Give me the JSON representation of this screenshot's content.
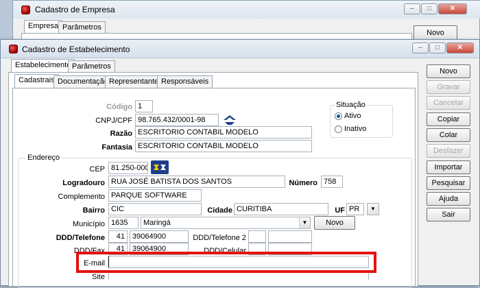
{
  "bg_window": {
    "title": "Cadastro de Empresa",
    "tabs": [
      "Empresa",
      "Parâmetros"
    ],
    "novo_label": "Novo"
  },
  "window": {
    "title": "Cadastro de Estabelecimento",
    "tabs": [
      "Estabelecimento",
      "Parâmetros"
    ],
    "subtabs": [
      "Cadastrais",
      "Documentação",
      "Representante",
      "Responsáveis"
    ]
  },
  "buttons": {
    "novo": "Novo",
    "gravar": "Gravar",
    "cancelar": "Cancelar",
    "copiar": "Copiar",
    "colar": "Colar",
    "desfazer": "Desfazer",
    "importar": "Importar",
    "pesquisar": "Pesquisar",
    "ajuda": "Ajuda",
    "sair": "Sair"
  },
  "form": {
    "codigo_label": "Código",
    "codigo": "1",
    "cnpj_label": "CNPJ/CPF",
    "cnpj": "98.765.432/0001-98",
    "razao_label": "Razão",
    "razao": "ESCRITORIO CONTABIL MODELO",
    "fantasia_label": "Fantasia",
    "fantasia": "ESCRITORIO CONTABIL MODELO",
    "situacao_title": "Situação",
    "situacao_ativo": "Ativo",
    "situacao_inativo": "Inativo",
    "endereco_title": "Endereço",
    "cep_label": "CEP",
    "cep": "81.250-000",
    "logradouro_label": "Logradouro",
    "logradouro": "RUA JOSÉ BATISTA DOS SANTOS",
    "numero_label": "Número",
    "numero": "758",
    "complemento_label": "Complemento",
    "complemento": "PARQUE SOFTWARE",
    "bairro_label": "Bairro",
    "bairro": "CIC",
    "cidade_label": "Cidade",
    "cidade": "CURITIBA",
    "uf_label": "UF",
    "uf": "PR",
    "municipio_label": "Município",
    "municipio_code": "1635",
    "municipio": "Maringá",
    "municipio_novo": "Novo",
    "ddd_tel_label": "DDD/Telefone",
    "ddd_tel": "41",
    "tel": "39064900",
    "ddd_tel2_label": "DDD/Telefone 2",
    "ddd_tel2": "",
    "tel2": "",
    "ddd_fax_label": "DDD/Fax",
    "ddd_fax": "41",
    "fax": "39064900",
    "ddd_cel_label": "DDD/Celular",
    "ddd_cel": "",
    "cel": "",
    "email_label": "E-mail",
    "email": "",
    "site_label": "Site"
  },
  "highlight_color": "#e41111"
}
